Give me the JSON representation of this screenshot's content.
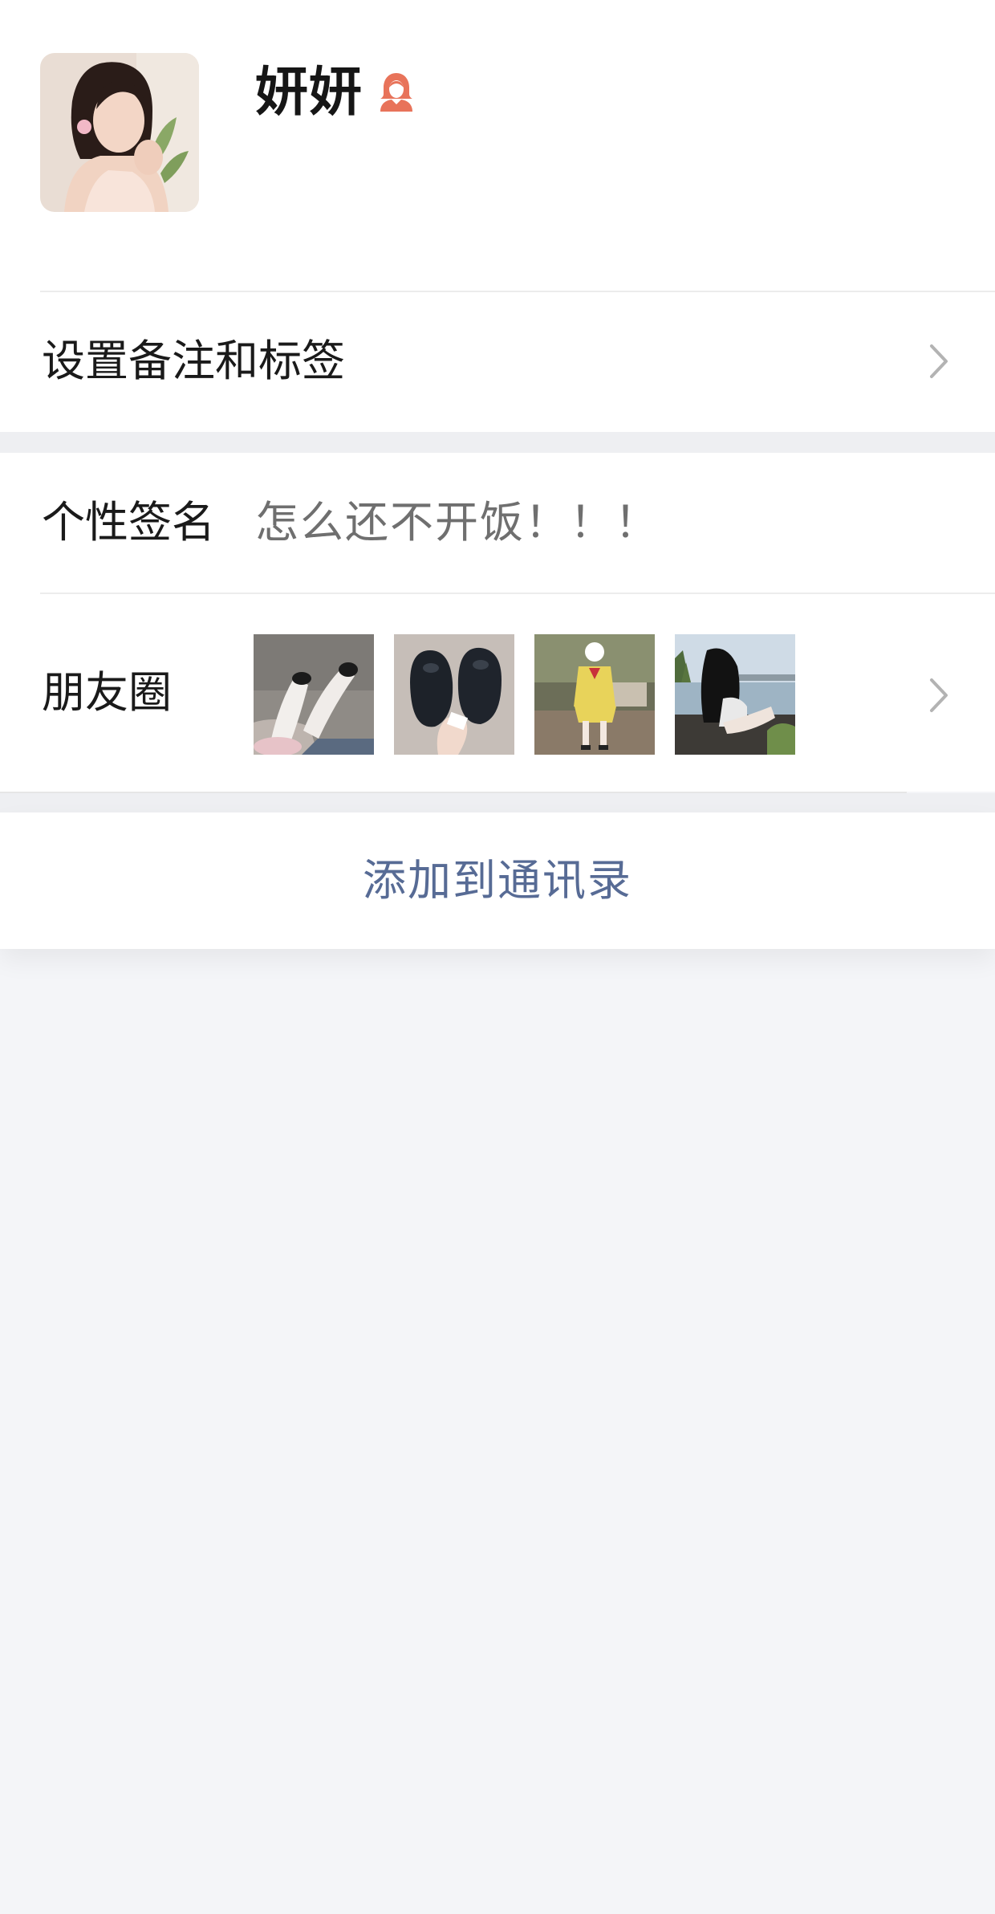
{
  "profile": {
    "nickname": "妍妍",
    "gender": "female",
    "gender_icon": "female-user-icon",
    "gender_color": "#e8735a"
  },
  "remark_row": {
    "label": "设置备注和标签"
  },
  "signature_row": {
    "label": "个性签名",
    "value": "怎么还不开饭！！！"
  },
  "moments_row": {
    "label": "朋友圈",
    "thumbnails": [
      "legs-in-white-stockings-photo",
      "black-shoes-photo",
      "girl-in-yellow-dress-photo",
      "girl-sitting-by-river-photo"
    ]
  },
  "action": {
    "add_to_contacts_label": "添加到通讯录",
    "color": "#576b95"
  },
  "colors": {
    "background": "#f4f5f8",
    "card": "#ffffff",
    "divider": "#ececec"
  }
}
